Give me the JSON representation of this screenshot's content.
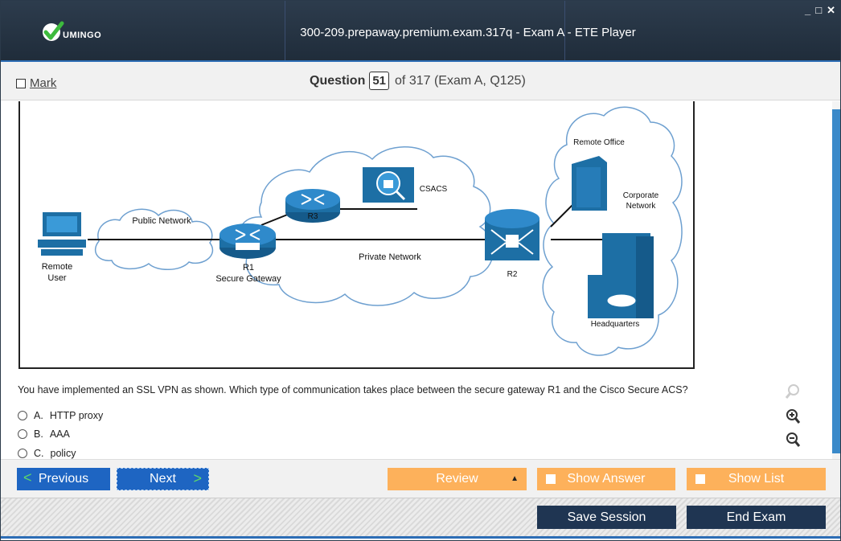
{
  "app": {
    "logo_text": "UMINGO",
    "window_title": "300-209.prepaway.premium.exam.317q - Exam A - ETE Player",
    "window_controls": [
      "minimize-icon",
      "maximize-icon",
      "close-icon"
    ]
  },
  "question_bar": {
    "mark_label": "Mark",
    "question_label": "Question",
    "question_number": "51",
    "question_of": "of 317 (Exam A, Q125)"
  },
  "exhibit": {
    "labels": {
      "remote_user": [
        "Remote",
        "User"
      ],
      "public_network": "Public Network",
      "r1": "R1",
      "secure_gateway": "Secure Gateway",
      "r3": "R3",
      "csacs": "CSACS",
      "private_network": "Private Network",
      "r2": "R2",
      "remote_office": "Remote Office",
      "corporate_network": [
        "Corporate",
        "Network"
      ],
      "headquarters": "Headquarters"
    }
  },
  "question": {
    "text": "You have implemented an SSL VPN as shown. Which type of communication takes place between the secure gateway R1 and the Cisco Secure ACS?",
    "options": [
      {
        "letter": "A.",
        "text": "HTTP proxy"
      },
      {
        "letter": "B.",
        "text": "AAA"
      },
      {
        "letter": "C.",
        "text": "policy"
      }
    ]
  },
  "toolbar": {
    "previous_label": "Previous",
    "next_label": "Next",
    "review_label": "Review",
    "show_answer_label": "Show Answer",
    "show_list_label": "Show List"
  },
  "footer": {
    "save_label": "Save Session",
    "end_label": "End Exam"
  },
  "colors": {
    "titlebar": "#1f2c3a",
    "accent_blue": "#1e65c2",
    "orange": "#fdb15b",
    "navy": "#1f3552",
    "scrollbar": "#3a89c9",
    "network_icon": "#1d6fa5"
  }
}
